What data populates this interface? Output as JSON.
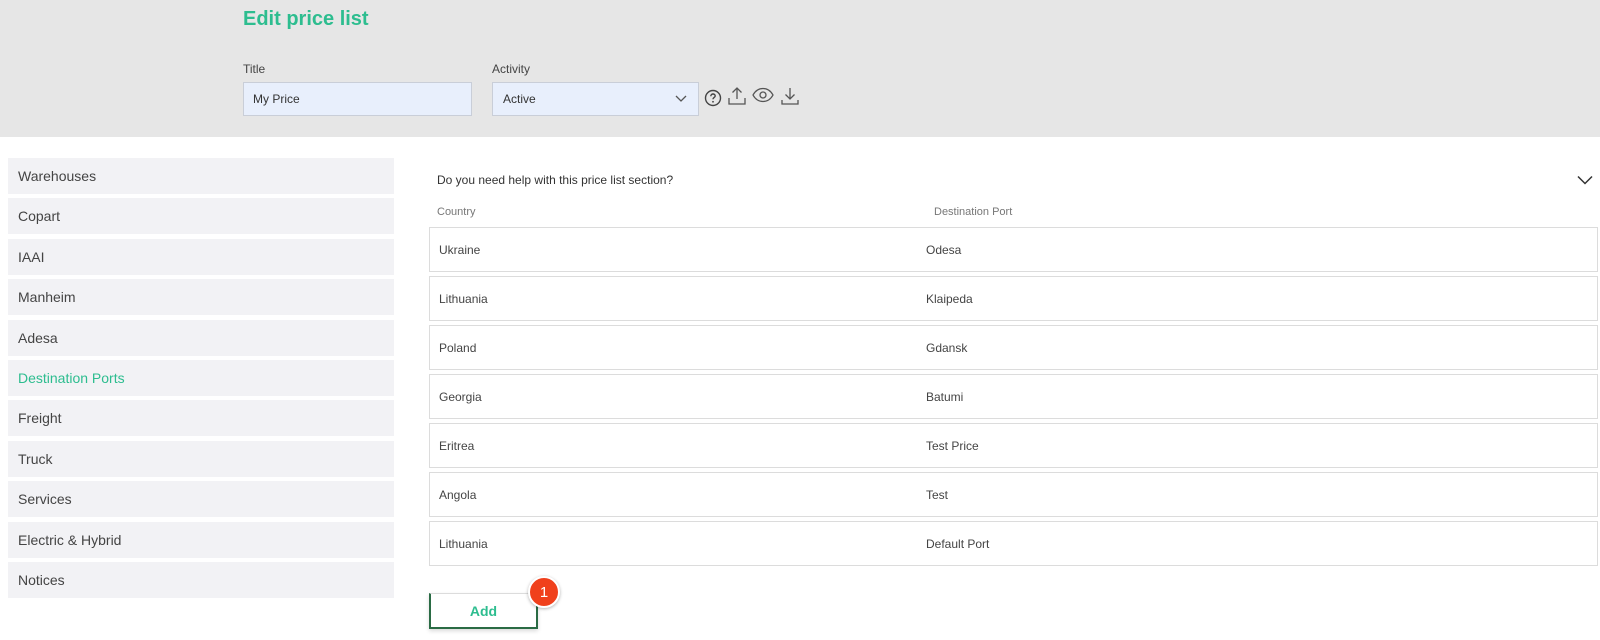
{
  "header": {
    "page_title": "Edit price list",
    "title_label": "Title",
    "title_value": "My Price",
    "activity_label": "Activity",
    "activity_value": "Active",
    "tool_icons": [
      "help-circle-icon",
      "upload-icon",
      "eye-icon",
      "download-icon"
    ]
  },
  "sidebar": {
    "items": [
      {
        "label": "Warehouses"
      },
      {
        "label": "Copart"
      },
      {
        "label": "IAAI"
      },
      {
        "label": "Manheim"
      },
      {
        "label": "Adesa"
      },
      {
        "label": "Destination Ports",
        "active": true
      },
      {
        "label": "Freight"
      },
      {
        "label": "Truck"
      },
      {
        "label": "Services"
      },
      {
        "label": "Electric & Hybrid"
      },
      {
        "label": "Notices"
      }
    ]
  },
  "main": {
    "help_text": "Do you need help with this price list section?",
    "columns": {
      "country": "Country",
      "port": "Destination Port"
    },
    "rows": [
      {
        "country": "Ukraine",
        "port": "Odesa"
      },
      {
        "country": "Lithuania",
        "port": "Klaipeda"
      },
      {
        "country": "Poland",
        "port": "Gdansk"
      },
      {
        "country": "Georgia",
        "port": "Batumi"
      },
      {
        "country": "Eritrea",
        "port": "Test Price"
      },
      {
        "country": "Angola",
        "port": "Test"
      },
      {
        "country": "Lithuania",
        "port": "Default Port"
      }
    ],
    "add_label": "Add",
    "badge_count": "1"
  },
  "colors": {
    "accent": "#2dbd8f",
    "header_bg": "#e6e6e6",
    "input_bg": "#e8effc",
    "sidebar_bg": "#f2f2f5",
    "badge": "#f0401c"
  }
}
